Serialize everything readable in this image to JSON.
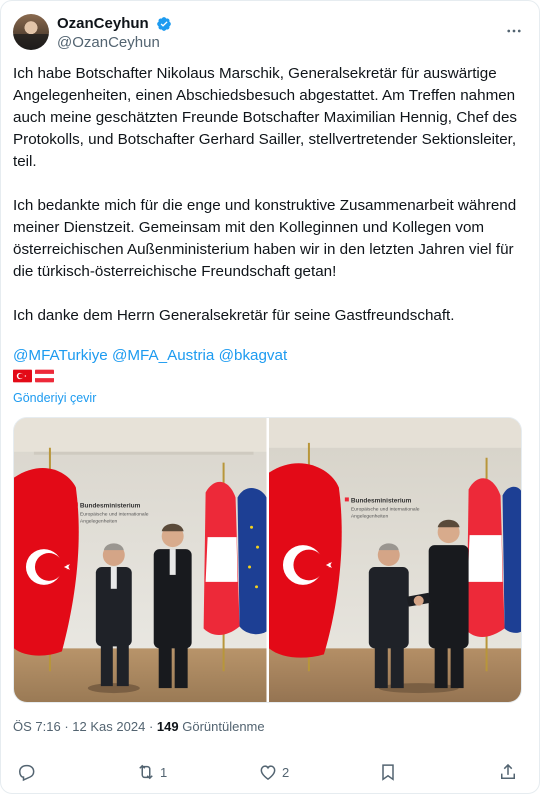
{
  "author": {
    "display_name": "OzanCeyhun",
    "handle": "@OzanCeyhun",
    "verified": true
  },
  "tweet": {
    "paragraphs": [
      "Ich habe Botschafter Nikolaus Marschik, Generalsekretär für auswärtige Angelegenheiten, einen Abschiedsbesuch abgestattet. Am Treffen nahmen auch meine geschätzten Freunde Botschafter Maximilian Hennig, Chef des Protokolls, und Botschafter Gerhard Sailler, stellvertretender Sektionsleiter, teil.",
      "Ich bedankte mich für die enge und konstruktive Zusammenarbeit während meiner Dienstzeit. Gemeinsam mit den Kolleginnen und Kollegen vom österreichischen Außenministerium haben wir in den letzten Jahren viel für die türkisch-österreichische Freundschaft getan!",
      "Ich danke dem Herrn Generalsekretär für seine Gastfreundschaft."
    ],
    "mentions": [
      "@MFATurkiye",
      "@MFA_Austria",
      "@bkagvat"
    ],
    "flags": [
      "turkey-flag",
      "austria-flag"
    ],
    "translate_label": "Gönderiyi çevir"
  },
  "media": {
    "photos": [
      {
        "name": "photo-left",
        "wall_text": [
          "Bundesministerium",
          "Europäische und internationale",
          "Angelegenheiten"
        ]
      },
      {
        "name": "photo-right",
        "wall_text": [
          "Bundesministerium",
          "Europäische und internationale",
          "Angelegenheiten"
        ]
      }
    ]
  },
  "meta": {
    "time": "ÖS 7:16",
    "separator": "·",
    "date": "12 Kas 2024",
    "views_count": "149",
    "views_label": "Görüntülenme"
  },
  "actions": {
    "reply_count": "",
    "retweet_count": "1",
    "like_count": "2"
  },
  "colors": {
    "text": "#0f1419",
    "secondary": "#536471",
    "link": "#1d9bf0",
    "verified": "#1d9bf0",
    "turkey_red": "#e30a17",
    "austria_red": "#ed2939"
  },
  "icons": [
    "verified-badge-icon",
    "more-icon",
    "reply-icon",
    "retweet-icon",
    "like-icon",
    "bookmark-icon",
    "share-icon"
  ]
}
